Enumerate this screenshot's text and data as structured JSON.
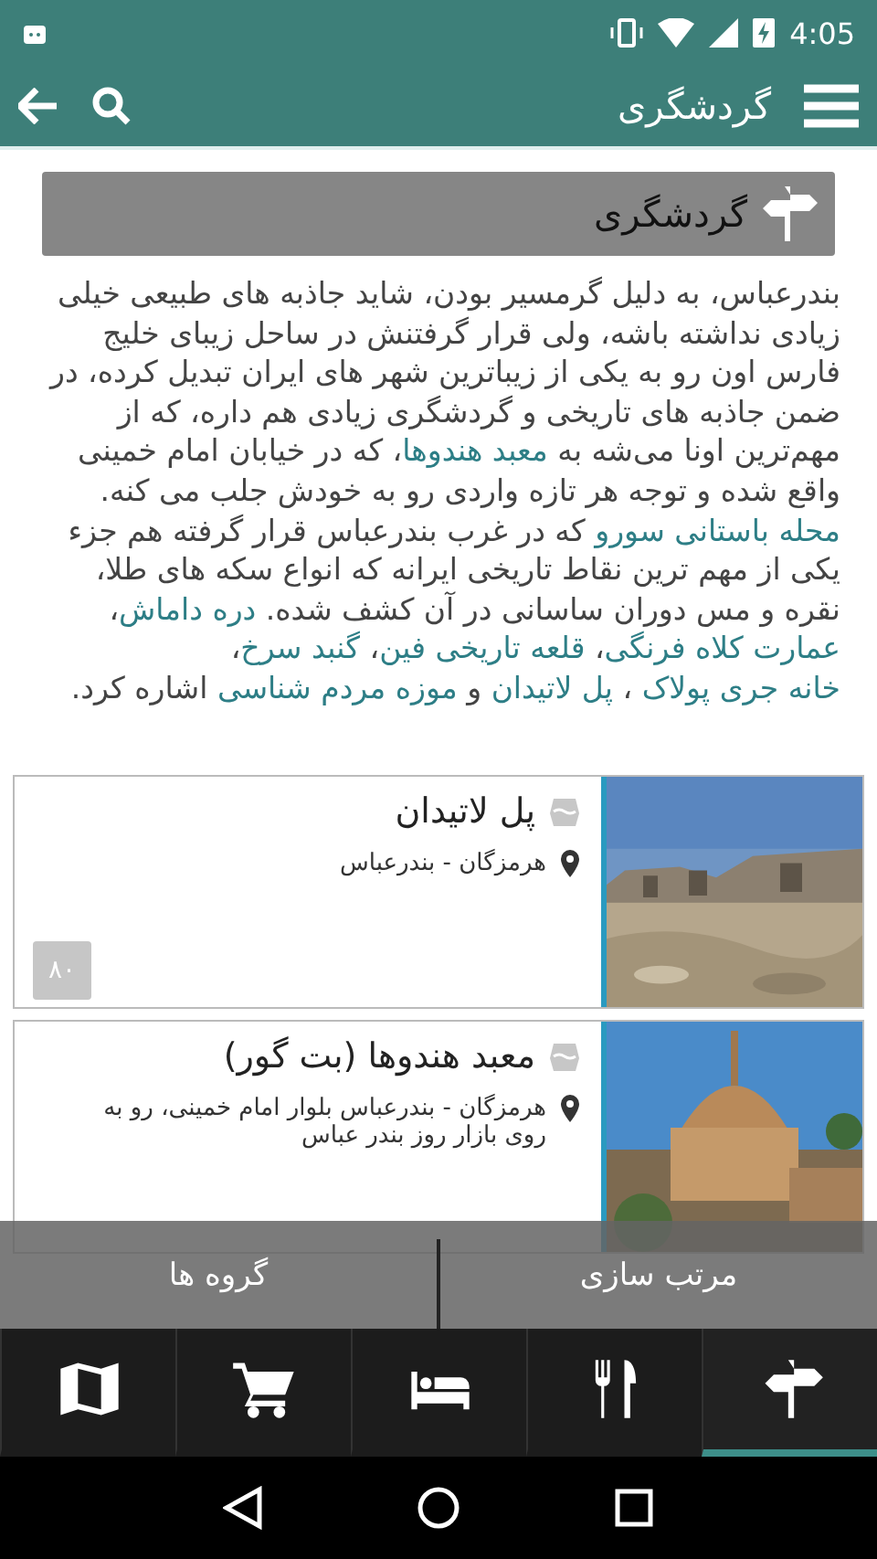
{
  "status_bar": {
    "time": "4:05"
  },
  "app_bar": {
    "title": "گردشگری"
  },
  "section": {
    "title": "گردشگری"
  },
  "paragraph": [
    {
      "kind": "text",
      "text": "بندرعباس، به دلیل گرمسیر بودن، شاید جاذبه های طبیعی خیلی زیادی نداشته باشه، ولی قرار گرفتنش در ساحل زیبای خلیج فارس اون رو به یکی از زیباترین شهر های ایران تبدیل کرده، در ضمن جاذبه های تاریخی و گردشگری زیادی هم داره، که از مهم‌ترین اونا می‌شه به "
    },
    {
      "kind": "link",
      "text": "معبد هندوها"
    },
    {
      "kind": "text",
      "text": "، که در خیابان امام خمینی واقع شده و توجه هر تازه واردی رو به خودش جلب می کنه. "
    },
    {
      "kind": "link",
      "text": "محله باستانی سورو"
    },
    {
      "kind": "text",
      "text": " که در غرب بندرعباس قرار گرفته هم جزء یکی از مهم ترین نقاط تاریخی ایرانه که انواع سکه های طلا، نقره و مس دوران ساسانی در آن کشف شده. "
    },
    {
      "kind": "link",
      "text": "دره داماش"
    },
    {
      "kind": "text",
      "text": "، "
    },
    {
      "kind": "link",
      "text": "عمارت کلاه فرنگی"
    },
    {
      "kind": "text",
      "text": "، "
    },
    {
      "kind": "link",
      "text": "قلعه تاریخی فین"
    },
    {
      "kind": "text",
      "text": "، "
    },
    {
      "kind": "link",
      "text": "گنبد سرخ"
    },
    {
      "kind": "text",
      "text": "، "
    },
    {
      "kind": "link",
      "text": "خانه جری پولاک"
    },
    {
      "kind": "text",
      "text": " ، "
    },
    {
      "kind": "link",
      "text": "پل لاتیدان"
    },
    {
      "kind": "text",
      "text": " و "
    },
    {
      "kind": "link",
      "text": "موزه مردم شناسی"
    },
    {
      "kind": "text",
      "text": " اشاره کرد."
    }
  ],
  "places": [
    {
      "name": "پل لاتیدان",
      "address": "هرمزگان - بندرعباس",
      "badge": "۸۰"
    },
    {
      "name": "معبد هندوها (بت گور)",
      "address": "هرمزگان - بندرعباس بلوار امام خمینی، رو به روی بازار روز بندر عباس"
    }
  ],
  "overlay_buttons": [
    {
      "label": "مرتب سازی"
    },
    {
      "label": "گروه ها"
    }
  ],
  "bottom_nav": [
    {
      "selected": true
    },
    {
      "selected": false
    },
    {
      "selected": false
    },
    {
      "selected": false
    },
    {
      "selected": false
    }
  ]
}
